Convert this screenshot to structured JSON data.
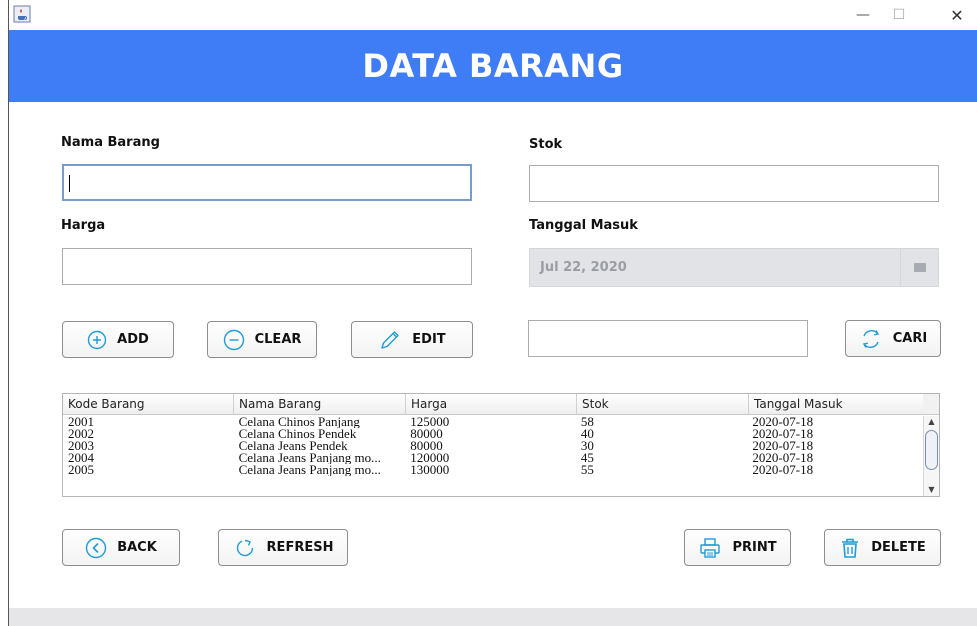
{
  "window": {
    "minimize": "—",
    "maximize": "☐",
    "close": "✕",
    "app_icon": "java-cup-icon"
  },
  "header": {
    "title": "DATA BARANG",
    "color": "#3f7df6"
  },
  "form": {
    "nama_barang_label": "Nama Barang",
    "nama_barang_value": "",
    "stok_label": "Stok",
    "stok_value": "",
    "harga_label": "Harga",
    "harga_value": "",
    "tanggal_label": "Tanggal Masuk",
    "tanggal_value": "Jul 22, 2020",
    "cari_value": ""
  },
  "buttons": {
    "add": "ADD",
    "clear": "CLEAR",
    "edit": "EDIT",
    "cari": "CARI",
    "back": "BACK",
    "refresh": "REFRESH",
    "print": "PRINT",
    "delete": "DELETE"
  },
  "table": {
    "columns": [
      "Kode Barang",
      "Nama Barang",
      "Harga",
      "Stok",
      "Tanggal Masuk"
    ],
    "rows": [
      [
        "2001",
        "Celana Chinos Panjang",
        "125000",
        "58",
        "2020-07-18"
      ],
      [
        "2002",
        "Celana Chinos Pendek",
        "80000",
        "40",
        "2020-07-18"
      ],
      [
        "2003",
        "Celana Jeans Pendek",
        "80000",
        "30",
        "2020-07-18"
      ],
      [
        "2004",
        "Celana Jeans Panjang mo...",
        "120000",
        "45",
        "2020-07-18"
      ],
      [
        "2005",
        "Celana Jeans Panjang mo...",
        "130000",
        "55",
        "2020-07-18"
      ]
    ]
  }
}
